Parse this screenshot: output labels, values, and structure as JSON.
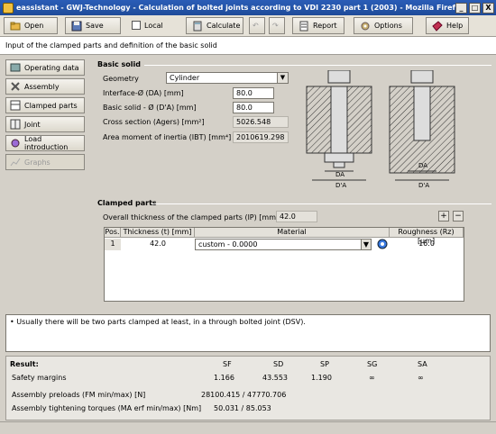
{
  "window": {
    "title": "eassistant - GWJ-Technology - Calculation of bolted joints according to VDI 2230 part 1 (2003) - Mozilla Firefox",
    "controls": [
      "_",
      "□",
      "X"
    ]
  },
  "toolbar": {
    "open": "Open",
    "save": "Save",
    "local": "Local",
    "calculate": "Calculate",
    "report": "Report",
    "options": "Options",
    "help": "Help"
  },
  "headline": "Input of the clamped parts and definition of the basic solid",
  "sidebar": {
    "items": [
      {
        "label": "Operating data",
        "enabled": true
      },
      {
        "label": "Assembly",
        "enabled": true
      },
      {
        "label": "Clamped parts",
        "enabled": true
      },
      {
        "label": "Joint",
        "enabled": true
      },
      {
        "label": "Load introduction",
        "enabled": true
      },
      {
        "label": "Graphs",
        "enabled": false
      }
    ]
  },
  "basic_solid": {
    "title": "Basic solid",
    "geometry_label": "Geometry",
    "geometry_value": "Cylinder",
    "interface_label": "Interface-Ø (DA) [mm]",
    "interface_value": "80.0",
    "basic_solid_label": "Basic solid - Ø (D'A) [mm]",
    "basic_solid_value": "80.0",
    "cross_section_label": "Cross section (Agers) [mm²]",
    "cross_section_value": "5026.548",
    "moment_label": "Area moment of inertia (IBT) [mm⁴]",
    "moment_value": "2010619.298",
    "diagram_labels": {
      "da1": "DA",
      "dpa1": "D'A",
      "da2": "DA",
      "dpa2": "D'A"
    }
  },
  "clamped_parts": {
    "title": "Clamped parts",
    "overall_label": "Overall thickness of the clamped parts (lP) [mm]",
    "overall_value": "42.0",
    "columns": [
      "Pos.",
      "Thickness (t) [mm]",
      "Material",
      "Roughness (Rz) [µm]"
    ],
    "rows": [
      {
        "pos": "1",
        "thickness": "42.0",
        "material": "custom - 0.0000",
        "roughness": "16.0"
      }
    ]
  },
  "message": "• Usually there will be two parts clamped at least, in a through bolted joint (DSV).",
  "result": {
    "title": "Result:",
    "headers": [
      "SF",
      "SD",
      "SP",
      "SG",
      "SA"
    ],
    "safety_label": "Safety margins",
    "safety_values": [
      "1.166",
      "43.553",
      "1.190",
      "∞",
      "∞"
    ],
    "preload_label": "Assembly preloads (FM min/max) [N]",
    "preload_value": "28100.415 / 47770.706",
    "torque_label": "Assembly tightening torques (MA erf min/max) [Nm]",
    "torque_value": "50.031 / 85.053"
  },
  "colors": {
    "titlebar": "#2a5db7",
    "accent": "#0a2a7a"
  }
}
